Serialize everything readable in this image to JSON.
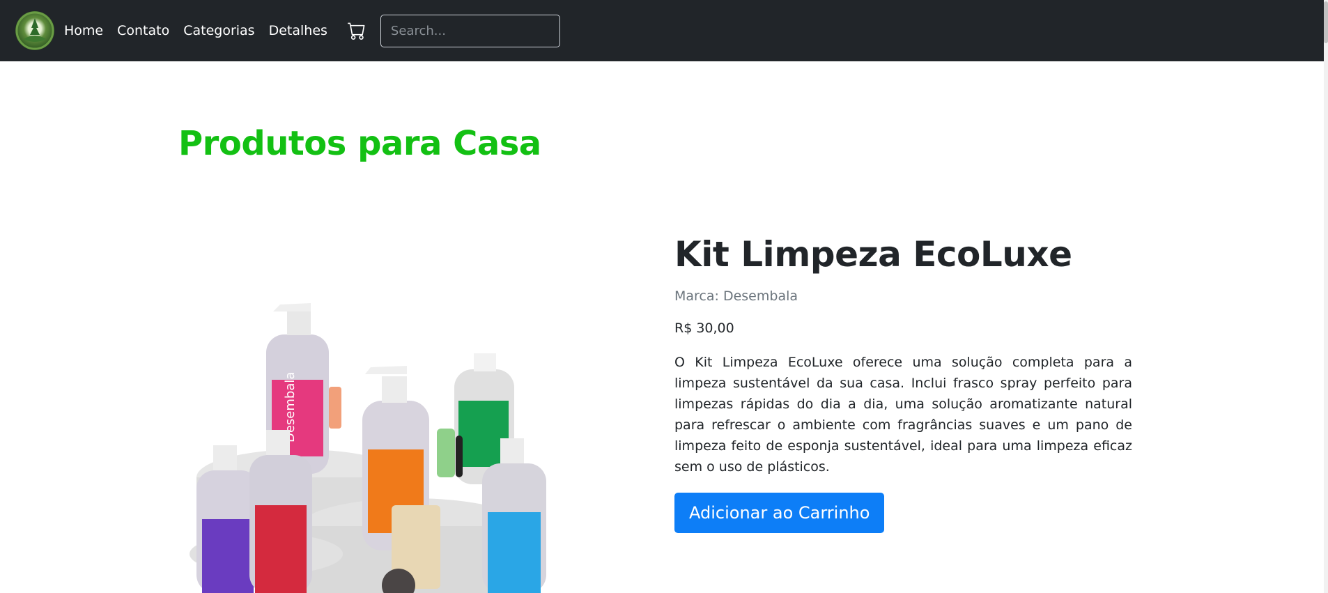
{
  "nav": {
    "links": [
      "Home",
      "Contato",
      "Categorias",
      "Detalhes"
    ],
    "search_placeholder": "Search..."
  },
  "page": {
    "title": "Produtos para Casa"
  },
  "product": {
    "name": "Kit Limpeza EcoLuxe",
    "brand": "Marca: Desembala",
    "price": "R$ 30,00",
    "description": "O Kit Limpeza EcoLuxe oferece uma solução completa para a limpeza sustentável da sua casa. Inclui frasco spray perfeito para limpezas rápidas do dia a dia, uma solução aromatizante natural para refrescar o ambiente com fragrâncias suaves e um pano de limpeza feito de esponja sustentável, ideal para uma limpeza eficaz sem o uso de plásticos.",
    "add_to_cart_label": "Adicionar ao Carrinho",
    "image_bottle_label": "Desembala"
  },
  "colors": {
    "navbar_bg": "#212529",
    "title_green": "#13c013",
    "button_blue": "#0d7ef7"
  },
  "icons": {
    "cart": "cart-icon",
    "logo": "logo-icon"
  }
}
